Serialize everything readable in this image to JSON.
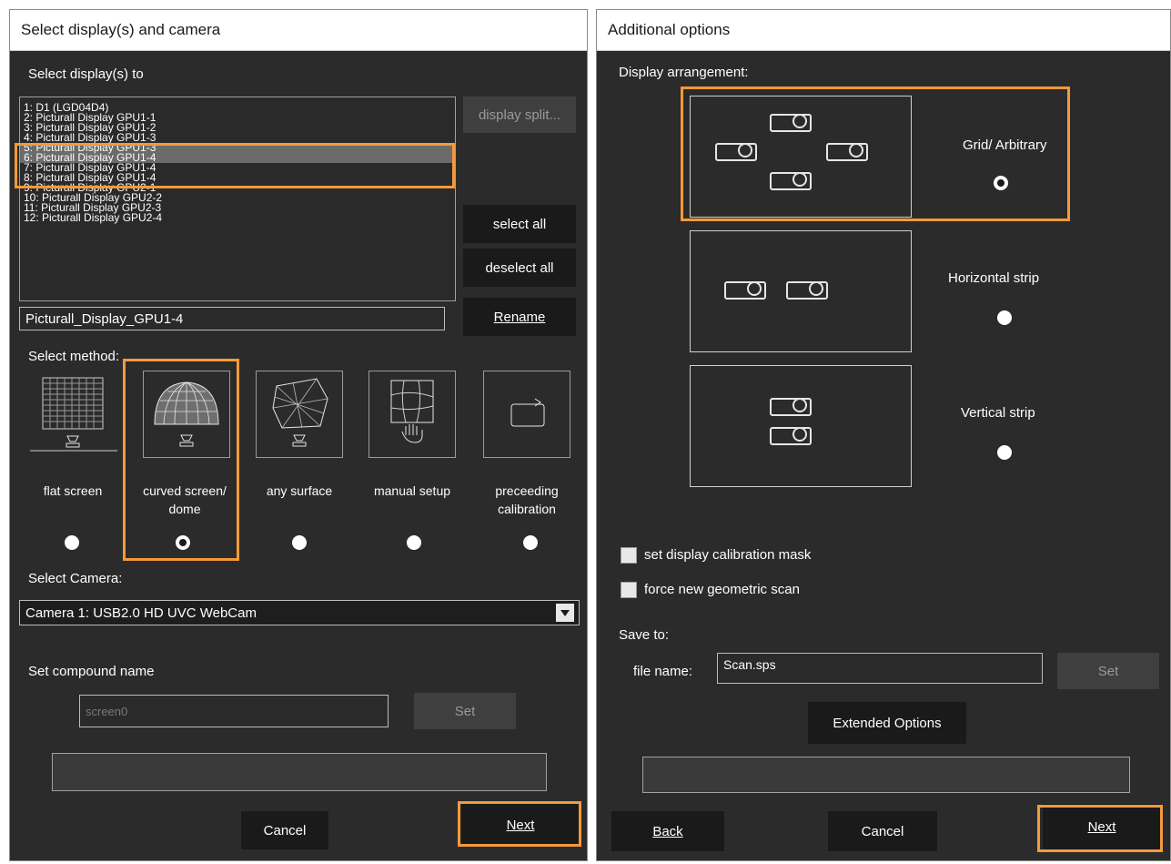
{
  "left": {
    "title": "Select display(s) and camera",
    "displays_label": "Select display(s) to",
    "displays": [
      "1: D1 (LGD04D4)",
      "2: Picturall Display GPU1-1",
      "3: Picturall Display GPU1-2",
      "4: Picturall Display GPU1-3",
      "5: Picturall Display GPU1-3",
      "6: Picturall Display GPU1-4",
      "7: Picturall Display GPU1-4",
      "8: Picturall Display GPU1-4",
      "9: Picturall Display GPU2-1",
      "10: Picturall Display GPU2-2",
      "11: Picturall Display GPU2-3",
      "12: Picturall Display GPU2-4"
    ],
    "display_split_label": "display split...",
    "select_all_label": "select all",
    "deselect_all_label": "deselect all",
    "display_name_value": "Picturall_Display_GPU1-4",
    "rename_label": "Rename",
    "method_label": "Select method:",
    "methods": [
      {
        "label": "flat screen",
        "icon": "flat-screen-icon"
      },
      {
        "label": "curved screen/ dome",
        "icon": "dome-icon"
      },
      {
        "label": "any surface",
        "icon": "any-surface-icon"
      },
      {
        "label": "manual setup",
        "icon": "manual-setup-icon"
      },
      {
        "label": "preceeding calibration",
        "icon": "preceeding-calibration-icon"
      }
    ],
    "selected_method": "curved screen/ dome",
    "camera_label": "Select Camera:",
    "camera_value": "Camera 1: USB2.0 HD UVC WebCam",
    "compound_label": "Set compound name",
    "compound_placeholder": "screen0",
    "set_label": "Set",
    "cancel_label": "Cancel",
    "next_label": "Next"
  },
  "right": {
    "title": "Additional options",
    "arrangement_label": "Display arrangement:",
    "arrangements": [
      {
        "label": "Grid/ Arbitrary",
        "checked": true
      },
      {
        "label": "Horizontal strip",
        "checked": false
      },
      {
        "label": "Vertical strip",
        "checked": false
      }
    ],
    "mask_label": "set display calibration mask",
    "force_scan_label": "force new geometric scan",
    "save_to_label": "Save to:",
    "file_name_label": "file name:",
    "file_name_value": "Scan.sps",
    "set_label": "Set",
    "extended_label": "Extended Options",
    "back_label": "Back",
    "cancel_label": "Cancel",
    "next_label": "Next"
  },
  "colors": {
    "highlight": "#f39a3b",
    "panel_bg": "#2b2b2b",
    "button_bg": "#1a1a1a"
  }
}
